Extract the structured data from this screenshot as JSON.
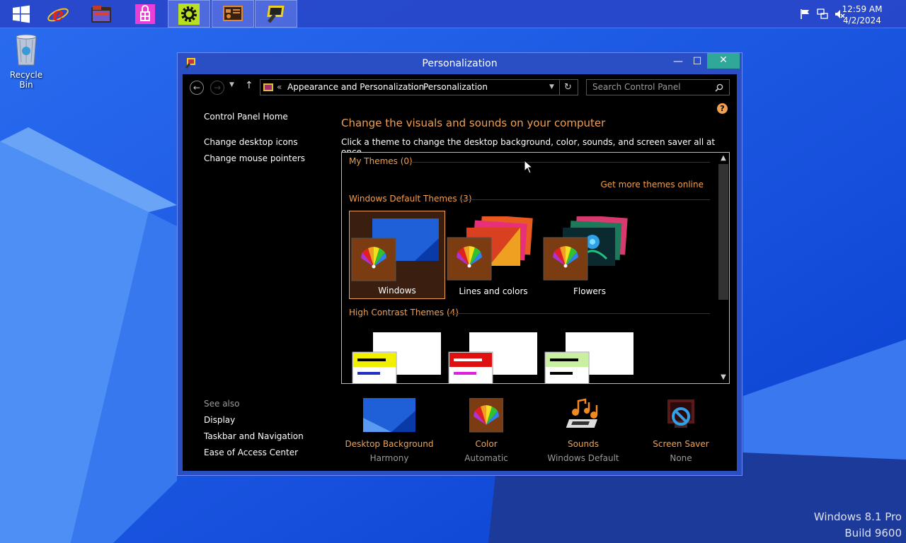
{
  "colors": {
    "accent": "#f0a050",
    "window_bg": "#000000",
    "taskbar": "#2846c8",
    "desktop": "#1a56e0"
  },
  "taskbar": {
    "apps": [
      {
        "name": "start-button",
        "icon": "windows-logo-icon"
      },
      {
        "name": "internet-explorer",
        "icon": "ie-icon"
      },
      {
        "name": "file-explorer",
        "icon": "folder-icon"
      },
      {
        "name": "store",
        "icon": "store-icon"
      },
      {
        "name": "settings",
        "icon": "gear-icon"
      },
      {
        "name": "control-panel",
        "icon": "control-panel-icon"
      },
      {
        "name": "personalization",
        "icon": "personalization-icon"
      }
    ],
    "clock_time": "12:59 AM",
    "clock_date": "4/2/2024"
  },
  "desktop": {
    "recycle_bin_label": "Recycle Bin",
    "watermark_line1": "Windows 8.1 Pro",
    "watermark_line2": "Build 9600"
  },
  "window": {
    "title": "Personalization",
    "minimize": "—",
    "maximize": "☐",
    "close": "✕",
    "breadcrumb_prefix": "«",
    "breadcrumb_1": "Appearance and Personalization",
    "breadcrumb_sep": "›",
    "breadcrumb_2": "Personalization",
    "search_placeholder": "Search Control Panel"
  },
  "left_pane": {
    "home": "Control Panel Home",
    "links": [
      "Change desktop icons",
      "Change mouse pointers"
    ],
    "see_also_title": "See also",
    "see_also": [
      "Display",
      "Taskbar and Navigation",
      "Ease of Access Center"
    ]
  },
  "main": {
    "heading": "Change the visuals and sounds on your computer",
    "subtext": "Click a theme to change the desktop background, color, sounds, and screen saver all at once.",
    "my_themes": "My Themes (0)",
    "get_more": "Get more themes online",
    "default_themes": "Windows Default Themes (3)",
    "themes": [
      "Windows",
      "Lines and colors",
      "Flowers"
    ],
    "high_contrast": "High Contrast Themes (4)"
  },
  "bottom": [
    {
      "title": "Desktop Background",
      "value": "Harmony",
      "icon": "desktop-background-icon"
    },
    {
      "title": "Color",
      "value": "Automatic",
      "icon": "color-icon"
    },
    {
      "title": "Sounds",
      "value": "Windows Default",
      "icon": "sounds-icon"
    },
    {
      "title": "Screen Saver",
      "value": "None",
      "icon": "screen-saver-icon"
    }
  ]
}
